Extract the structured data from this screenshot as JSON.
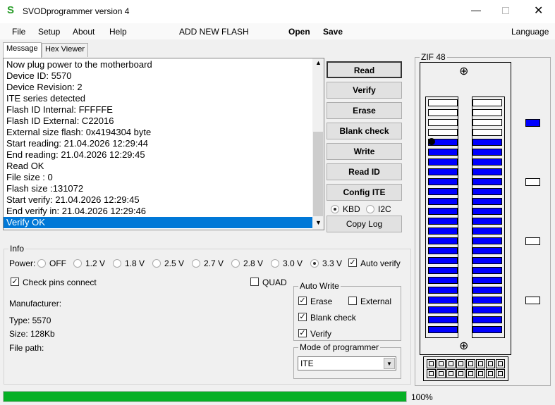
{
  "window": {
    "title": "SVODprogrammer version 4",
    "logo": "S",
    "controls": [
      "minimize",
      "maximize",
      "close"
    ]
  },
  "menu": {
    "file": "File",
    "setup": "Setup",
    "about": "About",
    "help": "Help",
    "add_flash": "ADD NEW FLASH",
    "open": "Open",
    "save": "Save",
    "language": "Language"
  },
  "tabs": [
    "Message",
    "Hex Viewer"
  ],
  "log": [
    "Now plug power to the motherboard",
    "Device ID: 5570",
    "Device Revision: 2",
    "ITE series detected",
    "Flash ID Internal: FFFFFE",
    "Flash ID External: C22016",
    "External size flash: 0x4194304 byte",
    "Start reading: 21.04.2026 12:29:44",
    "End reading: 21.04.2026 12:29:45",
    "Read OK",
    "File size : 0",
    "Flash size :131072",
    "Start verify: 21.04.2026 12:29:45",
    "End verify in: 21.04.2026 12:29:46",
    "Verify OK"
  ],
  "buttons": [
    "Read",
    "Verify",
    "Erase",
    "Blank check",
    "Write",
    "Read ID",
    "Config ITE"
  ],
  "interface": {
    "kbd": "KBD",
    "i2c": "I2C",
    "selected": "KBD"
  },
  "copy_log": "Copy Log",
  "info": {
    "title": "Info",
    "power_label": "Power:",
    "power_options": [
      "OFF",
      "1.2 V",
      "1.8 V",
      "2.5 V",
      "2.7 V",
      "2.8 V",
      "3.0 V",
      "3.3 V"
    ],
    "power_selected": "3.3 V",
    "auto_verify": "Auto verify",
    "auto_verify_checked": true,
    "check_pins": "Check pins connect",
    "check_pins_checked": true,
    "quad": "QUAD",
    "quad_checked": false,
    "manufacturer": "Manufacturer:",
    "type": "Type: 5570",
    "size": "Size: 128Kb",
    "file_path": "File path:"
  },
  "auto_write": {
    "title": "Auto Write",
    "erase": "Erase",
    "external": "External",
    "blank_check": "Blank check",
    "verify": "Verify"
  },
  "mode": {
    "title": "Mode of programmer",
    "value": "ITE"
  },
  "zif": {
    "title": "ZIF 48",
    "pins_per_side": 24,
    "inactive_top_pins": 4,
    "active_color": "#0000ff",
    "indicators": [
      true,
      false,
      false,
      false
    ]
  },
  "progress": {
    "value": 100,
    "label": "100%",
    "color": "#06b025"
  }
}
